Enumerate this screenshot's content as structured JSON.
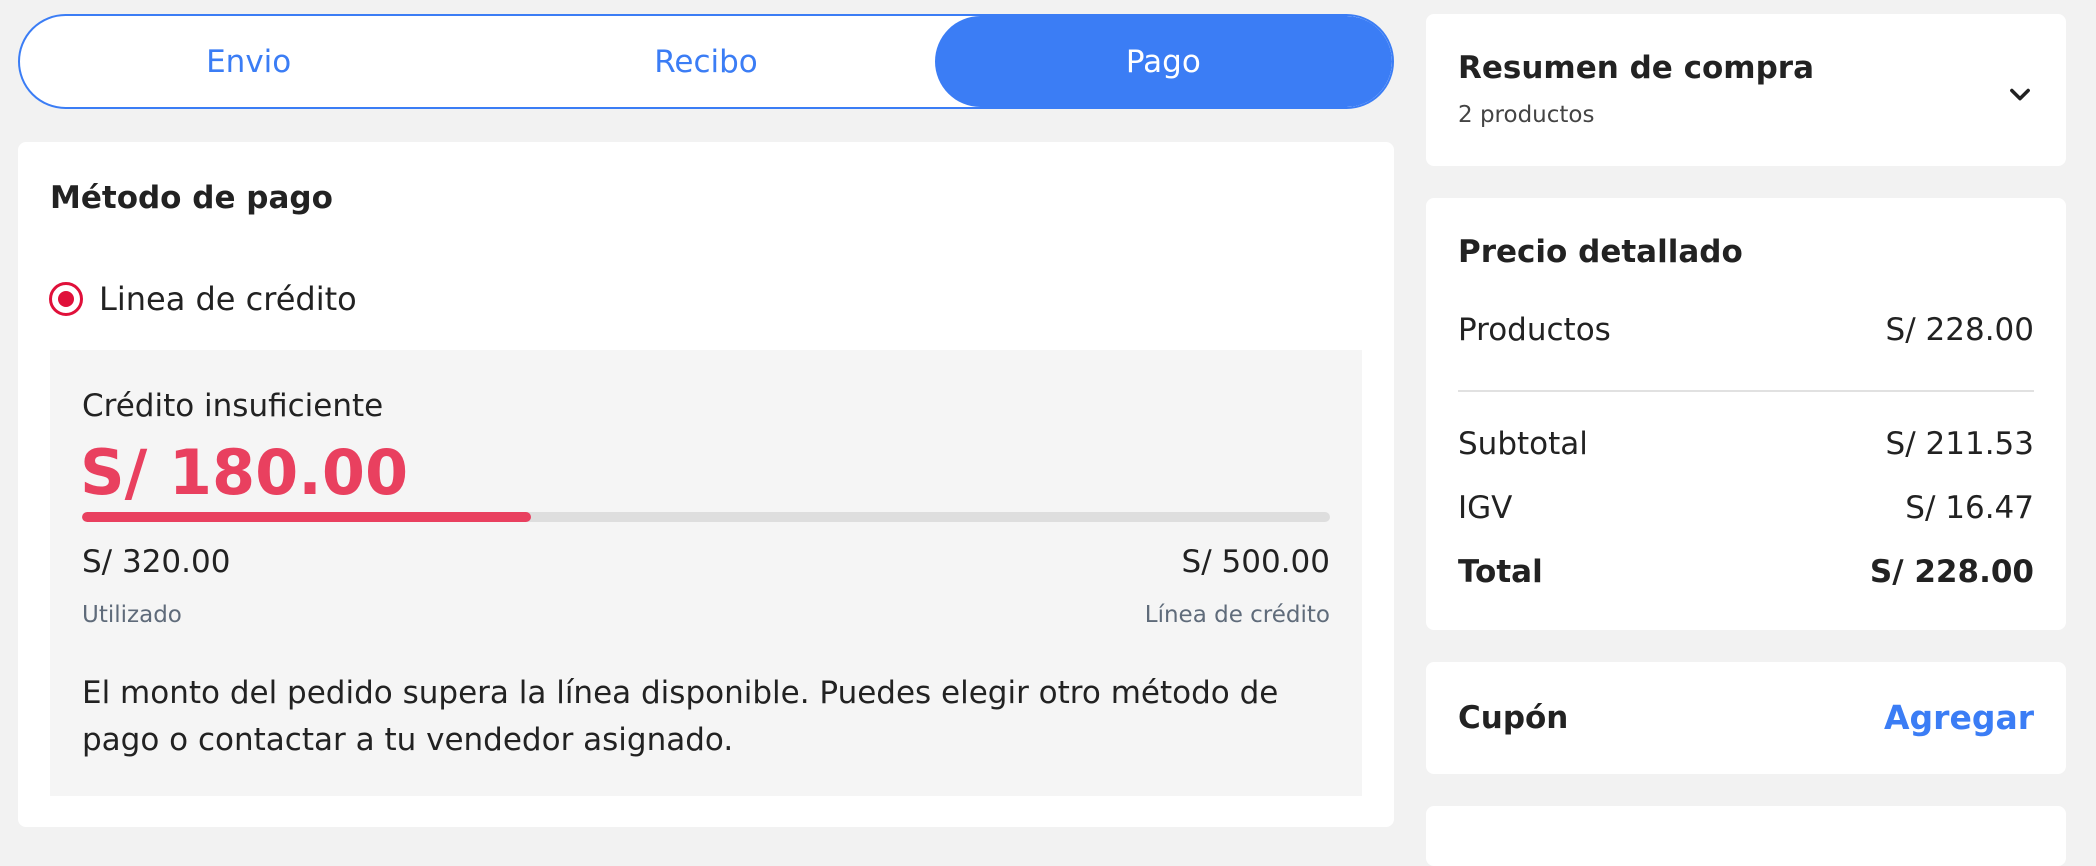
{
  "steps": [
    {
      "label": "Envio",
      "active": false
    },
    {
      "label": "Recibo",
      "active": false
    },
    {
      "label": "Pago",
      "active": true
    }
  ],
  "payment": {
    "title": "Método de pago",
    "option_label": "Linea de crédito",
    "option_selected": true,
    "credit": {
      "caption": "Crédito insuficiente",
      "amount": "S/ 180.00",
      "used_value": "S/ 320.00",
      "used_label": "Utilizado",
      "limit_value": "S/ 500.00",
      "limit_label": "Línea de crédito",
      "progress_fraction": 0.36,
      "message": "El monto del pedido supera la línea disponible. Puedes elegir otro método de pago o contactar a tu vendedor asignado."
    }
  },
  "summary": {
    "title": "Resumen de compra",
    "subtitle": "2 productos",
    "toggle_icon": "chevron-down-icon"
  },
  "price": {
    "title": "Precio detallado",
    "products_label": "Productos",
    "products_value": "S/ 228.00",
    "subtotal_label": "Subtotal",
    "subtotal_value": "S/ 211.53",
    "igv_label": "IGV",
    "igv_value": "S/ 16.47",
    "total_label": "Total",
    "total_value": "S/ 228.00"
  },
  "coupon": {
    "title": "Cupón",
    "action": "Agregar"
  },
  "colors": {
    "accent": "#3b7df5",
    "danger": "#e9405f",
    "radio": "#e0103a",
    "background": "#f2f2f2"
  }
}
